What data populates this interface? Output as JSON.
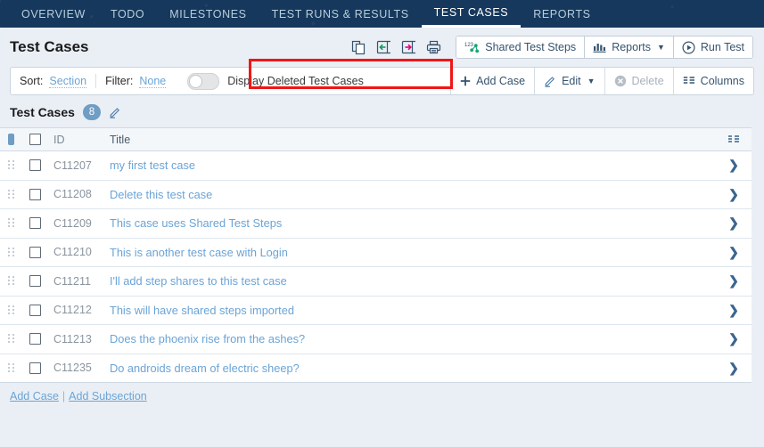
{
  "nav": {
    "tabs": [
      {
        "label": "OVERVIEW",
        "active": false
      },
      {
        "label": "TODO",
        "active": false
      },
      {
        "label": "MILESTONES",
        "active": false
      },
      {
        "label": "TEST RUNS & RESULTS",
        "active": false
      },
      {
        "label": "TEST CASES",
        "active": true
      },
      {
        "label": "REPORTS",
        "active": false
      }
    ]
  },
  "header": {
    "title": "Test Cases",
    "icons": [
      {
        "name": "copy-icon"
      },
      {
        "name": "import-icon"
      },
      {
        "name": "export-icon"
      },
      {
        "name": "print-icon"
      }
    ],
    "shared_test_steps_label": "Shared Test Steps",
    "reports_label": "Reports",
    "run_test_label": "Run Test"
  },
  "filter_bar": {
    "sort_label": "Sort:",
    "sort_value": "Section",
    "filter_label": "Filter:",
    "filter_value": "None",
    "toggle_label": "Display Deleted Test Cases",
    "toggle_on": false,
    "add_case_label": "Add Case",
    "edit_label": "Edit",
    "delete_label": "Delete",
    "columns_label": "Columns",
    "highlight_color": "#f01616"
  },
  "section": {
    "title": "Test Cases",
    "count": "8"
  },
  "table": {
    "columns": {
      "id": "ID",
      "title": "Title"
    },
    "rows": [
      {
        "id": "C11207",
        "title": "my first test case"
      },
      {
        "id": "C11208",
        "title": "Delete this test case"
      },
      {
        "id": "C11209",
        "title": "This case uses Shared Test Steps"
      },
      {
        "id": "C11210",
        "title": "This is another test case with Login"
      },
      {
        "id": "C11211",
        "title": "I'll add step shares to this test case"
      },
      {
        "id": "C11212",
        "title": "This will have shared steps imported"
      },
      {
        "id": "C11213",
        "title": "Does the phoenix rise from the ashes?"
      },
      {
        "id": "C11235",
        "title": "Do androids dream of electric sheep?"
      }
    ]
  },
  "footer": {
    "add_case_label": "Add Case",
    "separator": "|",
    "add_subsection_label": "Add Subsection"
  },
  "colors": {
    "navbar": "#16385c",
    "link": "#6ba4d6",
    "badge": "#6f9dc4",
    "page_bg": "#eaeff5"
  }
}
